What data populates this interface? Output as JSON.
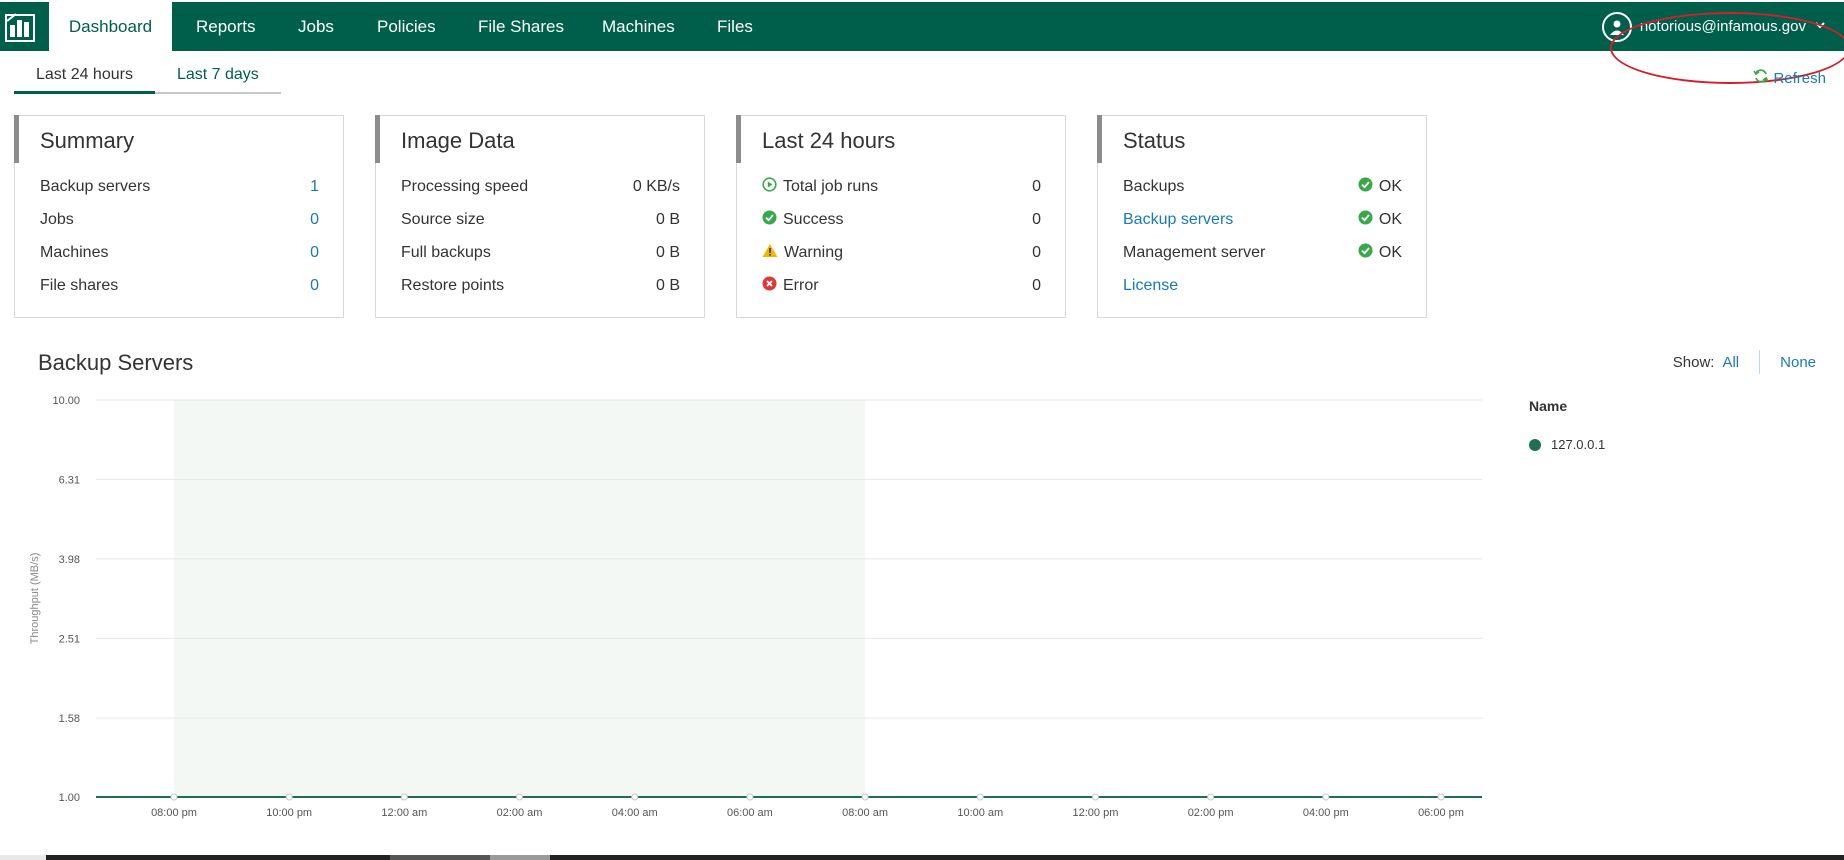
{
  "nav": {
    "items": [
      {
        "label": "Dashboard",
        "active": true
      },
      {
        "label": "Reports",
        "active": false
      },
      {
        "label": "Jobs",
        "active": false
      },
      {
        "label": "Policies",
        "active": false
      },
      {
        "label": "File Shares",
        "active": false
      },
      {
        "label": "Machines",
        "active": false
      },
      {
        "label": "Files",
        "active": false
      }
    ],
    "user": "notorious@infamous.gov",
    "logo_icon": "backup-logo-icon",
    "colors": {
      "brand": "#005f4b",
      "link": "#1a7ab5",
      "ok": "#3aa84a",
      "error": "#d83b3b",
      "warning": "#f2b705"
    }
  },
  "subtabs": [
    {
      "label": "Last 24 hours",
      "active": true
    },
    {
      "label": "Last 7 days",
      "active": false
    }
  ],
  "refresh_label": "Refresh",
  "cards": {
    "summary": {
      "title": "Summary",
      "rows": [
        {
          "label": "Backup servers",
          "value": "1"
        },
        {
          "label": "Jobs",
          "value": "0"
        },
        {
          "label": "Machines",
          "value": "0"
        },
        {
          "label": "File shares",
          "value": "0"
        }
      ]
    },
    "image_data": {
      "title": "Image Data",
      "rows": [
        {
          "label": "Processing speed",
          "value": "0 KB/s"
        },
        {
          "label": "Source size",
          "value": "0 B"
        },
        {
          "label": "Full backups",
          "value": "0 B"
        },
        {
          "label": "Restore points",
          "value": "0 B"
        }
      ]
    },
    "last24": {
      "title": "Last 24 hours",
      "rows": [
        {
          "label": "Total job runs",
          "value": "0",
          "icon": "play-circle-icon"
        },
        {
          "label": "Success",
          "value": "0",
          "icon": "check-circle-icon"
        },
        {
          "label": "Warning",
          "value": "0",
          "icon": "warning-triangle-icon"
        },
        {
          "label": "Error",
          "value": "0",
          "icon": "error-circle-icon"
        }
      ]
    },
    "status": {
      "title": "Status",
      "rows": [
        {
          "label": "Backups",
          "value": "OK"
        },
        {
          "label": "Backup servers",
          "value": "OK"
        },
        {
          "label": "Management server",
          "value": "OK"
        },
        {
          "label": "License",
          "value": ""
        }
      ]
    }
  },
  "backup_servers": {
    "title": "Backup Servers",
    "show_label": "Show:",
    "show_all": "All",
    "show_none": "None",
    "legend_title": "Name",
    "legend_items": [
      {
        "name": "127.0.0.1"
      }
    ]
  },
  "chart_data": {
    "type": "line",
    "ylabel": "Throughput (MB/s)",
    "y_ticks": [
      "10.00",
      "6.31",
      "3.98",
      "2.51",
      "1.58",
      "1.00"
    ],
    "x_ticks": [
      "08:00 pm",
      "10:00 pm",
      "12:00 am",
      "02:00 am",
      "04:00 am",
      "06:00 am",
      "08:00 am",
      "10:00 am",
      "12:00 pm",
      "02:00 pm",
      "04:00 pm",
      "06:00 pm"
    ],
    "y_scale": "log",
    "ylim": [
      1.0,
      10.0
    ],
    "highlight_range": [
      "08:00 pm",
      "08:00 am"
    ],
    "series": [
      {
        "name": "127.0.0.1",
        "color": "#1f6e55",
        "x": [
          "08:00 pm",
          "10:00 pm",
          "12:00 am",
          "02:00 am",
          "04:00 am",
          "06:00 am",
          "08:00 am",
          "10:00 am",
          "12:00 pm",
          "02:00 pm",
          "04:00 pm",
          "06:00 pm"
        ],
        "values": [
          1.0,
          1.0,
          1.0,
          1.0,
          1.0,
          1.0,
          1.0,
          1.0,
          1.0,
          1.0,
          1.0,
          1.0
        ]
      }
    ],
    "grid": true
  }
}
